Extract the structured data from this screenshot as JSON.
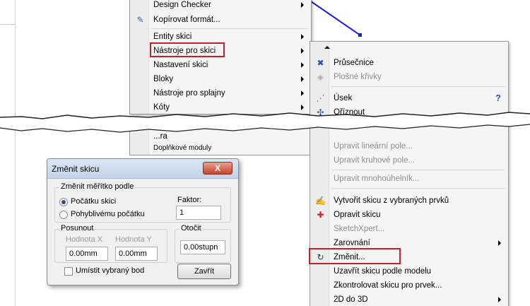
{
  "menu1": {
    "items": [
      {
        "label": "Design Checker",
        "has_submenu": true
      },
      {
        "label": "Kopírovat formát...",
        "icon": "format-painter-icon"
      },
      {
        "label": "Entity skici",
        "has_submenu": true
      },
      {
        "label": "Nástroje pro skici",
        "has_submenu": true,
        "highlighted": true
      },
      {
        "label": "Nastavení skici",
        "has_submenu": true
      },
      {
        "label": "Bloky",
        "has_submenu": true
      },
      {
        "label": "Nástroje pro splajny",
        "has_submenu": true
      },
      {
        "label": "Kóty",
        "has_submenu": true
      }
    ],
    "partial_lower": [
      "...ra",
      "Doplňkové moduly"
    ]
  },
  "menu2": {
    "items": [
      {
        "label": "Průsečnice",
        "icon": "intersection-icon"
      },
      {
        "label": "Plošné křivky",
        "icon": "face-curves-icon",
        "disabled": true
      },
      {
        "label": "Úsek",
        "icon": "segment-icon"
      },
      {
        "label": "Oříznout",
        "icon": "trim-icon"
      },
      {
        "label": "Upravit lineární pole...",
        "disabled": true
      },
      {
        "label": "Upravit kruhové pole...",
        "disabled": true
      },
      {
        "label": "Upravit mnohoúhelník...",
        "disabled": true
      },
      {
        "label": "Vytvořit skicu z vybraných prvků",
        "icon": "sketch-from-selection-icon"
      },
      {
        "label": "Opravit skicu",
        "icon": "repair-sketch-icon"
      },
      {
        "label": "SketchXpert...",
        "disabled": true
      },
      {
        "label": "Zarovnání",
        "has_submenu": true
      },
      {
        "label": "Změnit...",
        "icon": "modify-icon",
        "highlighted": true
      },
      {
        "label": "Uzavřít skicu podle modelu"
      },
      {
        "label": "Zkontrolovat skicu pro prvek..."
      },
      {
        "label": "2D do 3D",
        "has_submenu": true
      }
    ],
    "help_icon": "?"
  },
  "dialog": {
    "title": "Změnit skicu",
    "close_label": "X",
    "scale_group": "Změnit měřítko podle",
    "radio_origin": "Počátku skici",
    "radio_movable": "Pohyblivému počátku",
    "factor_label": "Faktor:",
    "factor_value": "1",
    "move_group": "Posunout",
    "x_label": "Hodnota X",
    "y_label": "Hodnota Y",
    "x_value": "0.00mm",
    "y_value": "0.00mm",
    "rotate_group": "Otočit",
    "rotate_value": "0.00stupn",
    "place_checkbox": "Umístit vybraný bod",
    "close_button": "Zavřít"
  },
  "colors": {
    "highlight": "#c8202a",
    "sketch_line": "#1a1adb"
  }
}
